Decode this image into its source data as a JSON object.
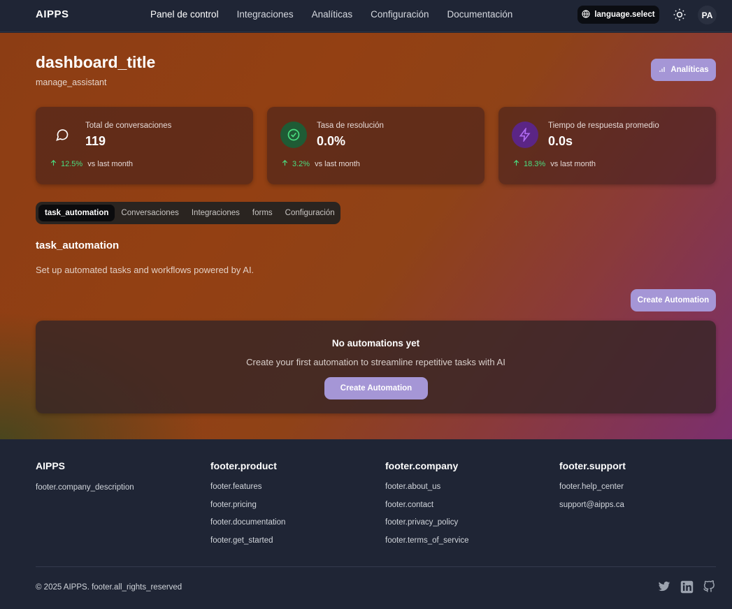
{
  "nav": {
    "logo": "AIPPS",
    "links": [
      "Panel de control",
      "Integraciones",
      "Analíticas",
      "Configuración",
      "Documentación"
    ],
    "language_label": "language.select",
    "avatar_initials": "PA"
  },
  "header": {
    "title": "dashboard_title",
    "subtitle": "manage_assistant",
    "analytics_button": "Analíticas"
  },
  "stats": [
    {
      "label": "Total de conversaciones",
      "value": "119",
      "trend": "12.5%",
      "trend_text": "vs last month",
      "icon": "chat-bubble-icon",
      "icon_bg": "transparent",
      "icon_color": "#ffffff"
    },
    {
      "label": "Tasa de resolución",
      "value": "0.0%",
      "trend": "3.2%",
      "trend_text": "vs last month",
      "icon": "check-circle-icon",
      "icon_bg": "#1f5b35",
      "icon_color": "#4ade80"
    },
    {
      "label": "Tiempo de respuesta promedio",
      "value": "0.0s",
      "trend": "18.3%",
      "trend_text": "vs last month",
      "icon": "lightning-icon",
      "icon_bg": "#5b2585",
      "icon_color": "#b06bf2"
    }
  ],
  "tabs": [
    "task_automation",
    "Conversaciones",
    "Integraciones",
    "forms",
    "Configuración"
  ],
  "active_tab": "task_automation",
  "section": {
    "title": "task_automation",
    "description": "Set up automated tasks and workflows powered by AI.",
    "create_button": "Create Automation"
  },
  "empty_state": {
    "title": "No automations yet",
    "description": "Create your first automation to streamline repetitive tasks with AI",
    "button": "Create Automation"
  },
  "footer": {
    "brand": "AIPPS",
    "company_description": "footer.company_description",
    "product": {
      "heading": "footer.product",
      "links": [
        "footer.features",
        "footer.pricing",
        "footer.documentation",
        "footer.get_started"
      ]
    },
    "company": {
      "heading": "footer.company",
      "links": [
        "footer.about_us",
        "footer.contact",
        "footer.privacy_policy",
        "footer.terms_of_service"
      ]
    },
    "support": {
      "heading": "footer.support",
      "links": [
        "footer.help_center",
        "support@aipps.ca"
      ]
    },
    "copyright": "© 2025 AIPPS. footer.all_rights_reserved",
    "social_icons": [
      "twitter-icon",
      "linkedin-icon",
      "github-icon"
    ]
  },
  "colors": {
    "accent": "#a596d6",
    "positive": "#4ade80",
    "nav_bg": "#1f2535"
  }
}
